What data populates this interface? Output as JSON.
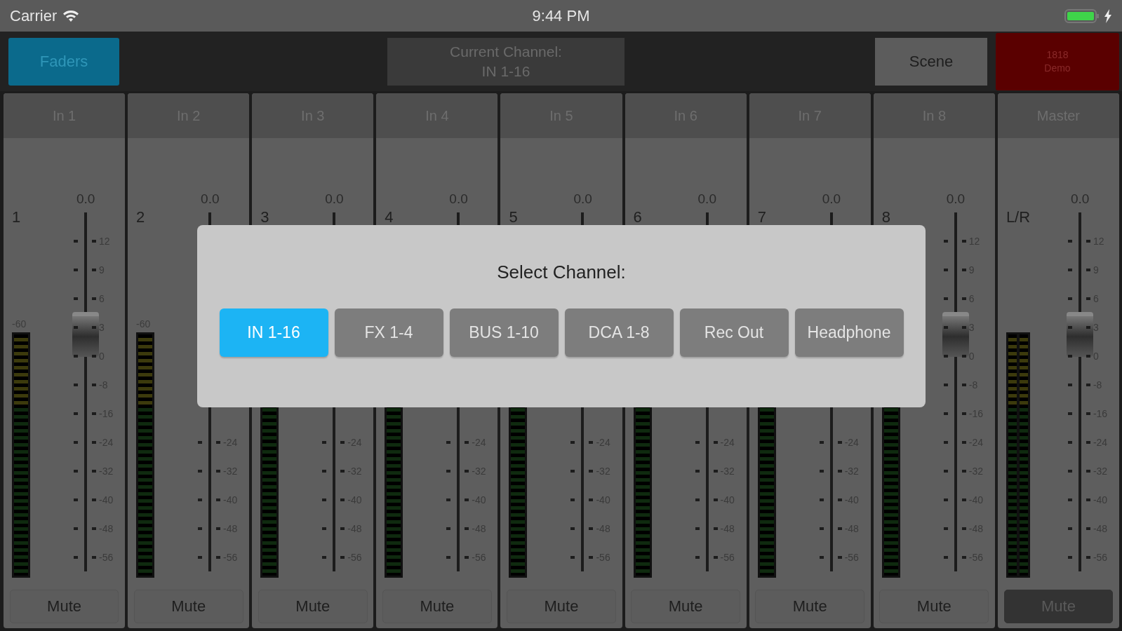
{
  "status_bar": {
    "carrier": "Carrier",
    "time": "9:44 PM"
  },
  "toolbar": {
    "faders_button": {
      "label": "Faders",
      "selected": true
    },
    "current_channel": [
      "Current Channel:",
      "IN 1-16"
    ],
    "scene_button": "Scene",
    "device_button": [
      "1818",
      "Demo"
    ]
  },
  "strips": [
    {
      "name": "In 1",
      "number": "1",
      "gain": "0.0",
      "meter_label": "-60",
      "scale": [
        "12",
        "9",
        "6",
        "3",
        "0",
        "-8",
        "-16",
        "-24",
        "-32",
        "-40",
        "-48",
        "-56"
      ],
      "level": 0.66,
      "mute": {
        "label": "Mute",
        "muted": false
      }
    },
    {
      "name": "In 2",
      "number": "2",
      "gain": "0.0",
      "meter_label": "-60",
      "scale": [
        "-24",
        "-32",
        "-40",
        "-48",
        "-56"
      ],
      "mute": {
        "label": "Mute",
        "muted": false
      }
    },
    {
      "name": "In 3",
      "number": "3",
      "gain": "0.0",
      "scale": [
        "-24",
        "-32",
        "-40",
        "-48",
        "-56"
      ],
      "mute": {
        "label": "Mute",
        "muted": false
      }
    },
    {
      "name": "In 4",
      "number": "4",
      "gain": "0.0",
      "scale": [
        "-24",
        "-32",
        "-40",
        "-48",
        "-56"
      ],
      "mute": {
        "label": "Mute",
        "muted": false
      }
    },
    {
      "name": "In 5",
      "number": "5",
      "gain": "0.0",
      "scale": [
        "-24",
        "-32",
        "-40",
        "-48",
        "-56"
      ],
      "mute": {
        "label": "Mute",
        "muted": false
      }
    },
    {
      "name": "In 6",
      "number": "6",
      "gain": "0.0",
      "scale": [
        "-24",
        "-32",
        "-40",
        "-48",
        "-56"
      ],
      "mute": {
        "label": "Mute",
        "muted": false
      }
    },
    {
      "name": "In 7",
      "number": "7",
      "gain": "0.0",
      "scale": [
        "-24",
        "-32",
        "-40",
        "-48",
        "-56"
      ],
      "mute": {
        "label": "Mute",
        "muted": false
      }
    },
    {
      "name": "In 8",
      "number": "8",
      "gain": "0.0",
      "scale": [
        "12",
        "9",
        "6",
        "3",
        "0",
        "-8",
        "-16",
        "-24",
        "-32",
        "-40",
        "-48",
        "-56"
      ],
      "level": 0.66,
      "mute": {
        "label": "Mute",
        "muted": false
      }
    },
    {
      "name": "Master",
      "number": "L/R",
      "gain": "0.0",
      "scale": [
        "12",
        "9",
        "6",
        "3",
        "0",
        "-8",
        "-16",
        "-24",
        "-32",
        "-40",
        "-48",
        "-56"
      ],
      "level": 0.66,
      "stereo": true,
      "mute": {
        "label": "Mute",
        "muted": true
      }
    }
  ],
  "dialog": {
    "title": "Select Channel:",
    "options": [
      {
        "label": "IN 1-16",
        "selected": true
      },
      {
        "label": "FX 1-4",
        "selected": false
      },
      {
        "label": "BUS 1-10",
        "selected": false
      },
      {
        "label": "DCA 1-8",
        "selected": false
      },
      {
        "label": "Rec Out",
        "selected": false
      },
      {
        "label": "Headphone",
        "selected": false
      }
    ]
  }
}
